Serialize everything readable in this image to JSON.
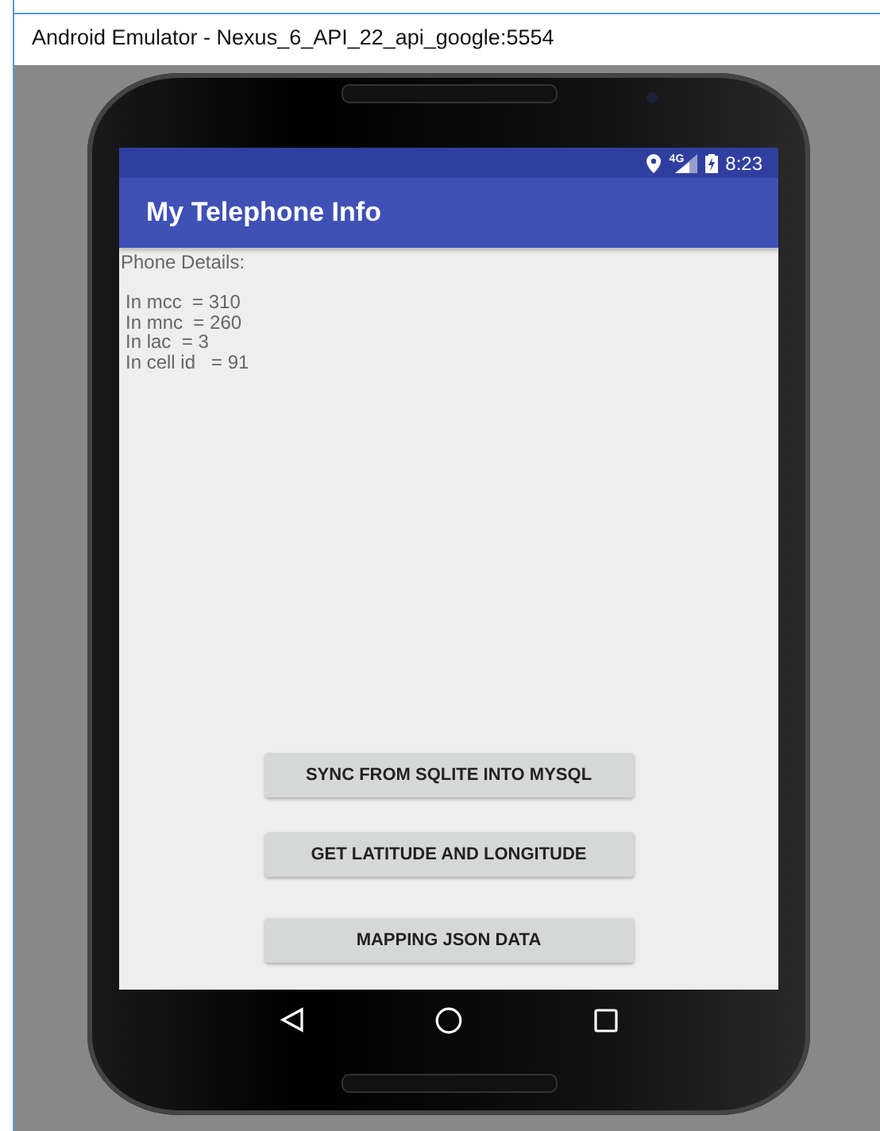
{
  "window": {
    "title": "Android Emulator - Nexus_6_API_22_api_google:5554"
  },
  "status_bar": {
    "network": "4G",
    "time": "8:23"
  },
  "app_bar": {
    "title": "My Telephone Info"
  },
  "content": {
    "heading": "Phone Details:",
    "lines": [
      "In mcc  = 310",
      "In mnc  = 260",
      "In lac  = 3",
      "In cell id   = 91"
    ]
  },
  "buttons": [
    "SYNC FROM SQLITE INTO MYSQL",
    "GET LATITUDE AND LONGITUDE",
    "MAPPING JSON DATA"
  ]
}
